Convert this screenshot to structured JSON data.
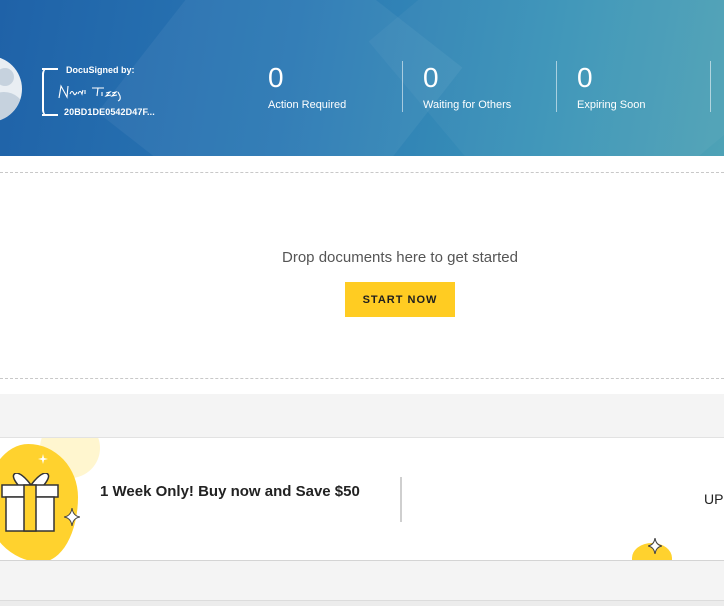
{
  "header": {
    "docusign": {
      "title": "DocuSigned by:",
      "envelope_id": "20BD1DE0542D47F..."
    },
    "stats": [
      {
        "count": "0",
        "label": "Action Required"
      },
      {
        "count": "0",
        "label": "Waiting for Others"
      },
      {
        "count": "0",
        "label": "Expiring Soon"
      }
    ]
  },
  "dropzone": {
    "prompt": "Drop documents here to get started",
    "start_button": "START NOW"
  },
  "promo": {
    "message": "1 Week Only! Buy now and Save $50",
    "cta_partial": "UP"
  },
  "colors": {
    "banner_start": "#1f62a8",
    "banner_end": "#4ea2b6",
    "accent_yellow": "#ffcc22"
  },
  "icons": [
    "avatar-icon",
    "signature-icon",
    "gift-icon",
    "sparkle-icon"
  ]
}
